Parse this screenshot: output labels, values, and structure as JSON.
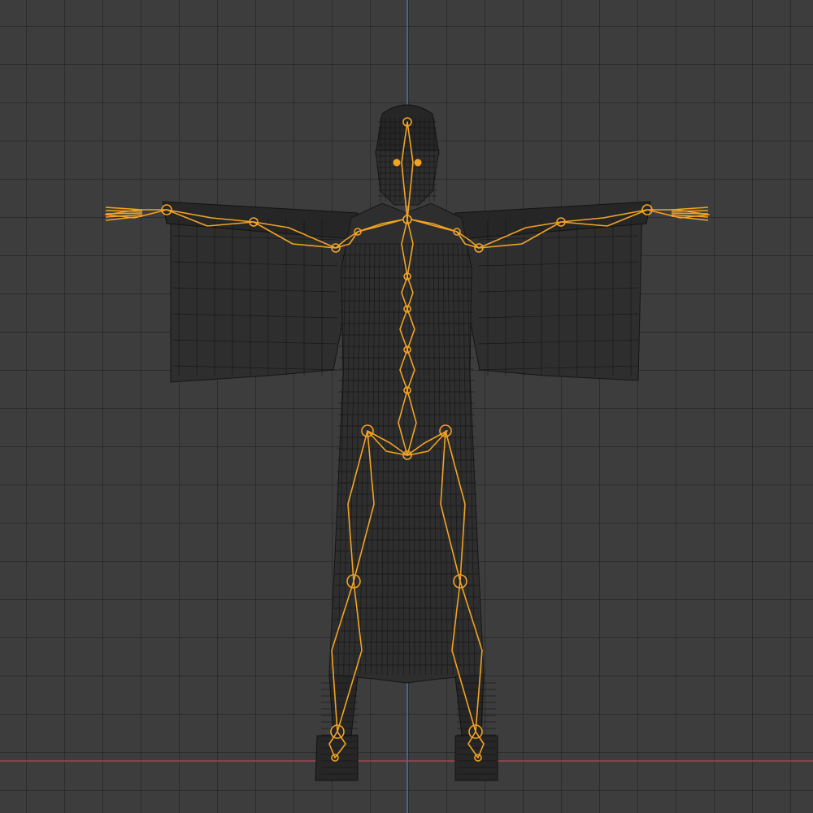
{
  "viewport": {
    "mode": "wireframe",
    "view": "front-orthographic",
    "background_color": "#3d3d3d",
    "grid_color": "#2a2a2a",
    "axis_colors": {
      "z": "#3e86c7",
      "x": "#b5475a"
    }
  },
  "armature": {
    "color": "#f1a324",
    "state": "selected",
    "bones": [
      "spine",
      "neck",
      "head",
      "shoulder-l",
      "upper-arm-l",
      "forearm-l",
      "hand-l",
      "shoulder-r",
      "upper-arm-r",
      "forearm-r",
      "hand-r",
      "hips",
      "thigh-l",
      "shin-l",
      "foot-l",
      "thigh-r",
      "shin-r",
      "foot-r"
    ]
  },
  "mesh": {
    "name": "character-robe",
    "display": "wire"
  }
}
